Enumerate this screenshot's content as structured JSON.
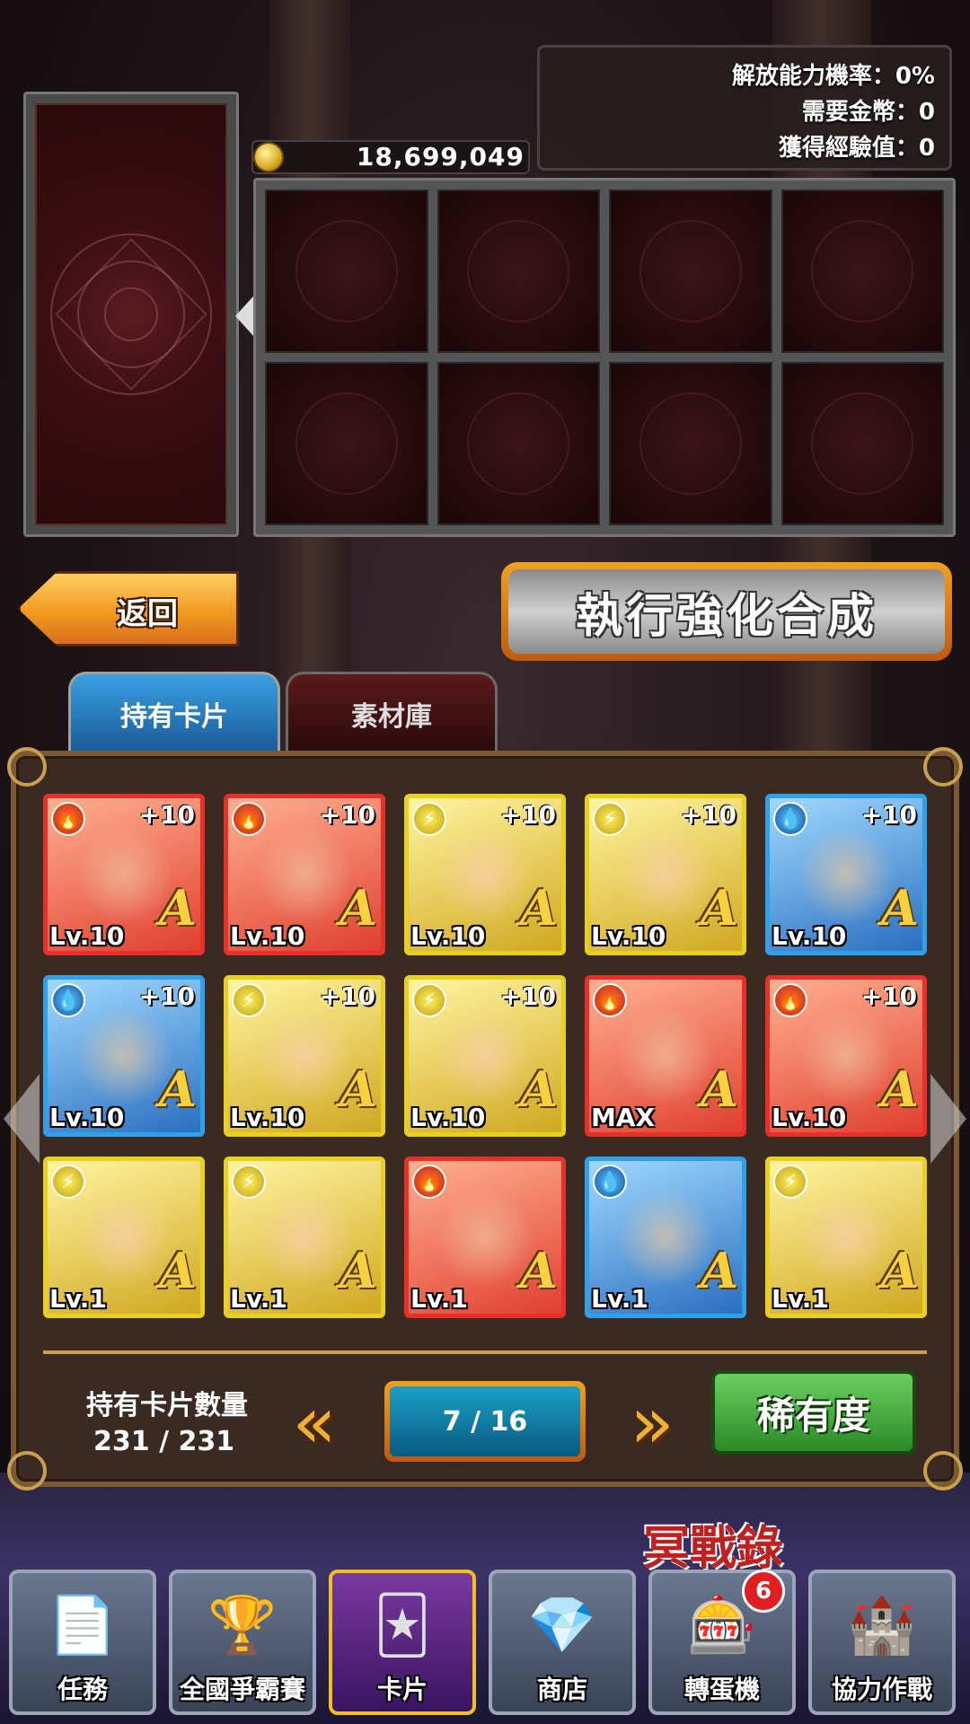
{
  "info": {
    "release_rate": "解放能力機率：0%",
    "coins_needed": "需要金幣：0",
    "exp_gained": "獲得經驗值：0"
  },
  "coins": "18,699,049",
  "buttons": {
    "back": "返回",
    "execute": "執行強化合成",
    "rarity": "稀有度"
  },
  "tabs": [
    "持有卡片",
    "素材庫"
  ],
  "cards": [
    {
      "element": "fire",
      "plus": "+10",
      "level": "Lv.10",
      "rank": "A",
      "icon": "fire-icon"
    },
    {
      "element": "fire",
      "plus": "+10",
      "level": "Lv.10",
      "rank": "A",
      "icon": "fire-icon"
    },
    {
      "element": "thunder",
      "plus": "+10",
      "level": "Lv.10",
      "rank": "A",
      "icon": "thunder-icon"
    },
    {
      "element": "thunder",
      "plus": "+10",
      "level": "Lv.10",
      "rank": "A",
      "icon": "thunder-icon"
    },
    {
      "element": "water",
      "plus": "+10",
      "level": "Lv.10",
      "rank": "A",
      "icon": "water-icon"
    },
    {
      "element": "water",
      "plus": "+10",
      "level": "Lv.10",
      "rank": "A",
      "icon": "water-icon"
    },
    {
      "element": "thunder",
      "plus": "+10",
      "level": "Lv.10",
      "rank": "A",
      "icon": "thunder-icon"
    },
    {
      "element": "thunder",
      "plus": "+10",
      "level": "Lv.10",
      "rank": "A",
      "icon": "thunder-icon"
    },
    {
      "element": "fire",
      "plus": "",
      "level": "MAX",
      "rank": "A",
      "icon": "fire-icon"
    },
    {
      "element": "fire",
      "plus": "+10",
      "level": "Lv.10",
      "rank": "A",
      "icon": "fire-icon"
    },
    {
      "element": "thunder",
      "plus": "",
      "level": "Lv.1",
      "rank": "A",
      "icon": "thunder-icon"
    },
    {
      "element": "thunder",
      "plus": "",
      "level": "Lv.1",
      "rank": "A",
      "icon": "thunder-icon"
    },
    {
      "element": "fire",
      "plus": "",
      "level": "Lv.1",
      "rank": "A",
      "icon": "fire-icon"
    },
    {
      "element": "water",
      "plus": "",
      "level": "Lv.1",
      "rank": "A",
      "icon": "water-icon"
    },
    {
      "element": "thunder",
      "plus": "",
      "level": "Lv.1",
      "rank": "A",
      "icon": "thunder-icon"
    }
  ],
  "card_count": {
    "label": "持有卡片數量",
    "value": "231 / 231"
  },
  "pager": {
    "page": "7 / 16"
  },
  "logo": "冥戰錄",
  "nav": [
    {
      "label": "任務",
      "icon": "document-icon"
    },
    {
      "label": "全國爭霸賽",
      "icon": "trophy-icon"
    },
    {
      "label": "卡片",
      "icon": "cards-icon"
    },
    {
      "label": "商店",
      "icon": "gems-icon"
    },
    {
      "label": "轉蛋機",
      "icon": "gacha-icon"
    },
    {
      "label": "協力作戰",
      "icon": "castle-icon"
    }
  ],
  "badge": "6",
  "colors": {
    "fire": "#e8302a",
    "thunder": "#e8d020",
    "water": "#30a0e8",
    "accent": "#f0a020"
  }
}
